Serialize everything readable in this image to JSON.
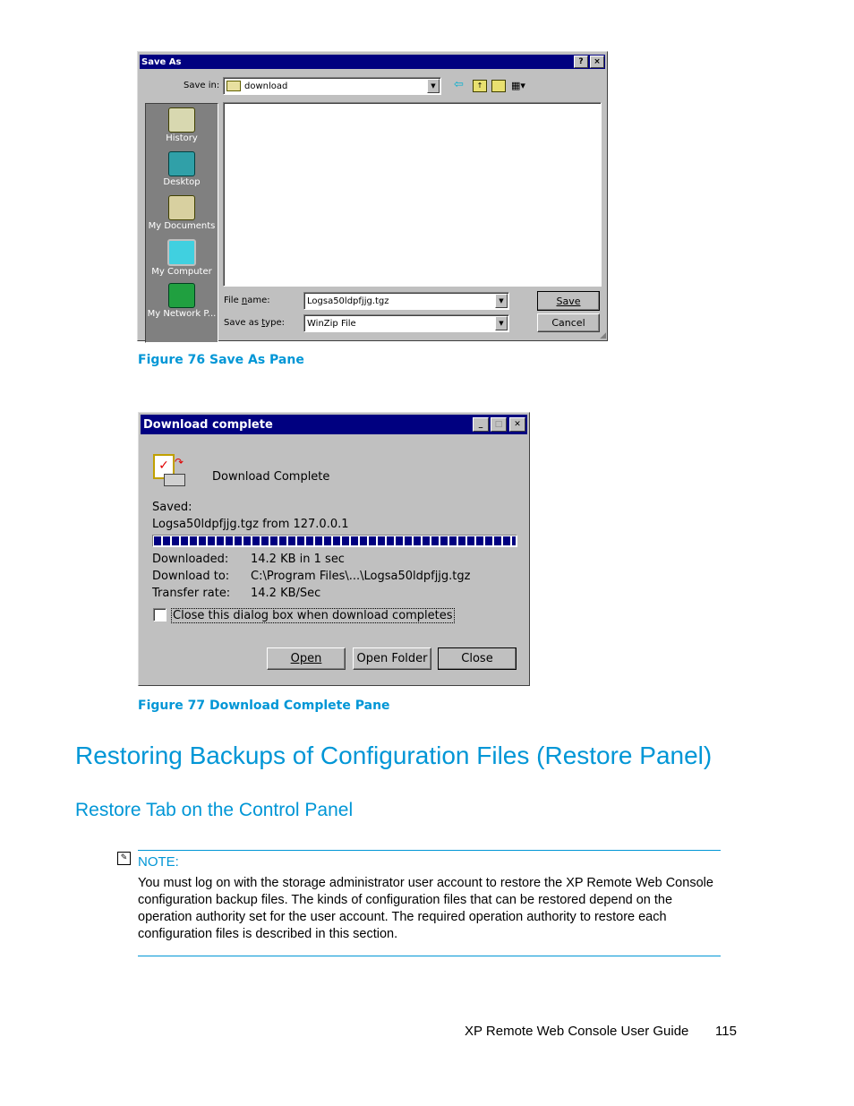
{
  "save_as": {
    "title": "Save As",
    "help_btn": "?",
    "close_btn": "×",
    "save_in_label": "Save in:",
    "save_in_value": "download",
    "places": [
      {
        "label": "History",
        "icon": "history-icon"
      },
      {
        "label": "Desktop",
        "icon": "desktop-icon"
      },
      {
        "label": "My Documents",
        "icon": "my-documents-icon"
      },
      {
        "label": "My Computer",
        "icon": "my-computer-icon"
      },
      {
        "label": "My Network P...",
        "icon": "my-network-places-icon"
      }
    ],
    "file_name_label": "File name:",
    "file_name_value": "Logsa50ldpfjjg.tgz",
    "save_type_label": "Save as type:",
    "save_type_value": "WinZip File",
    "save_button": "Save",
    "cancel_button": "Cancel"
  },
  "figure76": "Figure 76 Save As Pane",
  "download": {
    "title": "Download complete",
    "heading": "Download Complete",
    "saved_label": "Saved:",
    "saved_value": "Logsa50ldpfjjg.tgz from 127.0.0.1",
    "progress_percent": 100,
    "rows": [
      {
        "label": "Downloaded:",
        "value": "14.2 KB in 1 sec"
      },
      {
        "label": "Download to:",
        "value": "C:\\Program Files\\...\\Logsa50ldpfjjg.tgz"
      },
      {
        "label": "Transfer rate:",
        "value": "14.2 KB/Sec"
      }
    ],
    "checkbox_label": "Close this dialog box when download completes",
    "checkbox_checked": false,
    "open_button": "Open",
    "open_folder_button": "Open Folder",
    "close_button": "Close"
  },
  "figure77": "Figure 77 Download Complete Pane",
  "section_title": "Restoring Backups of Configuration Files (Restore Panel)",
  "subsection_title": "Restore Tab on the Control Panel",
  "note": {
    "label": "NOTE:",
    "text": "You must log on with the storage administrator user account to restore the XP Remote Web Console configuration backup files. The kinds of configuration files that can be restored depend on the operation authority set for the user account. The required operation authority to restore each configuration files is described in this section."
  },
  "footer": {
    "guide_title": "XP Remote Web Console User Guide",
    "page_number": "115"
  }
}
